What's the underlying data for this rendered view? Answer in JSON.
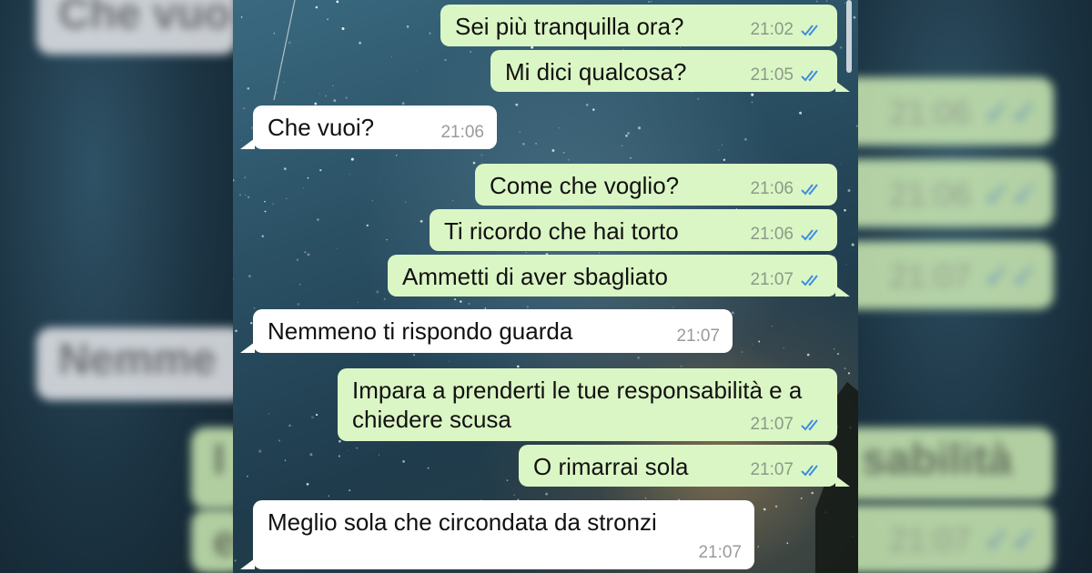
{
  "messages": [
    {
      "dir": "out",
      "text": "Sei più tranquilla ora?",
      "time": "21:02",
      "read": true
    },
    {
      "dir": "out",
      "text": "Mi dici qualcosa?",
      "time": "21:05",
      "read": true
    },
    {
      "dir": "in",
      "text": "Che vuoi?",
      "time": "21:06"
    },
    {
      "dir": "out",
      "text": "Come che voglio?",
      "time": "21:06",
      "read": true
    },
    {
      "dir": "out",
      "text": "Ti ricordo che hai torto",
      "time": "21:06",
      "read": true
    },
    {
      "dir": "out",
      "text": "Ammetti di aver sbagliato",
      "time": "21:07",
      "read": true
    },
    {
      "dir": "in",
      "text": "Nemmeno ti rispondo guarda",
      "time": "21:07"
    },
    {
      "dir": "out",
      "text": "Impara a prenderti le tue responsabilità e a chiedere scusa",
      "time": "21:07",
      "read": true
    },
    {
      "dir": "out",
      "text": "O rimarrai sola",
      "time": "21:07",
      "read": true
    },
    {
      "dir": "in",
      "text": "Meglio sola che circondata da stronzi",
      "time": "21:07"
    }
  ],
  "colors": {
    "outgoing_bubble": "#dbf6c5",
    "incoming_bubble": "#ffffff",
    "read_receipt": "#3f8de0"
  },
  "icons": {
    "read_receipt": "double-check-icon"
  },
  "background": {
    "left_fragments": [
      "Che vuo",
      "Nemme",
      "I",
      "e"
    ],
    "right_fragments": [
      "21:06",
      "21:06",
      "21:07",
      "sabilità",
      "21:07"
    ]
  }
}
